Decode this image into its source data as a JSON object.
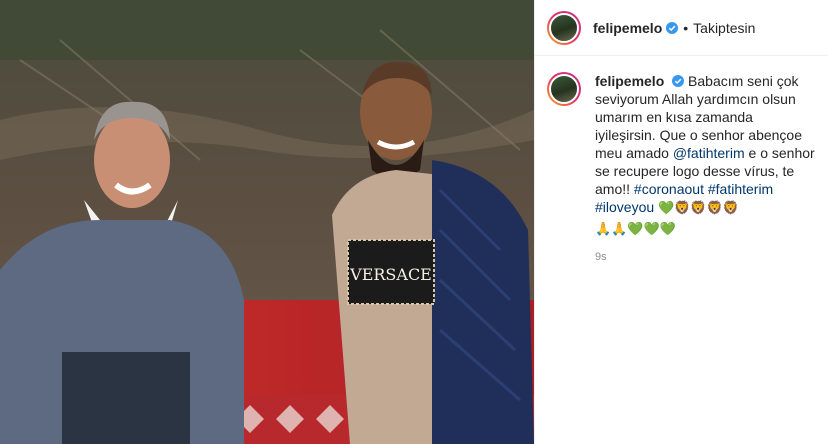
{
  "post": {
    "username": "felipemelo",
    "follow_status": "Takiptesin",
    "separator": "•"
  },
  "caption": {
    "username": "felipemelo",
    "line1": "Babacım seni çok seviyorum Allah yardımcın olsun umarım en kısa zamanda iyileşirsin. Que o senhor abençoe meu amado",
    "mention": "@fatihterim",
    "line2": "e o senhor se recupere logo desse vírus, te amo!!",
    "hashtag1": "#coronaout",
    "hashtag2": "#fatihterim",
    "hashtag3": "#iloveyou",
    "emojis_row1": [
      "💚",
      "🦁",
      "🦁",
      "🦁",
      "🦁"
    ],
    "emojis_row2": [
      "🙏",
      "🙏",
      "💚",
      "💚",
      "💚"
    ],
    "timestamp": "9s"
  },
  "photo": {
    "sweater_text": "VERSACE"
  },
  "colors": {
    "link": "#00376b",
    "verified": "#3897f0",
    "muted": "#8e8e8e"
  }
}
